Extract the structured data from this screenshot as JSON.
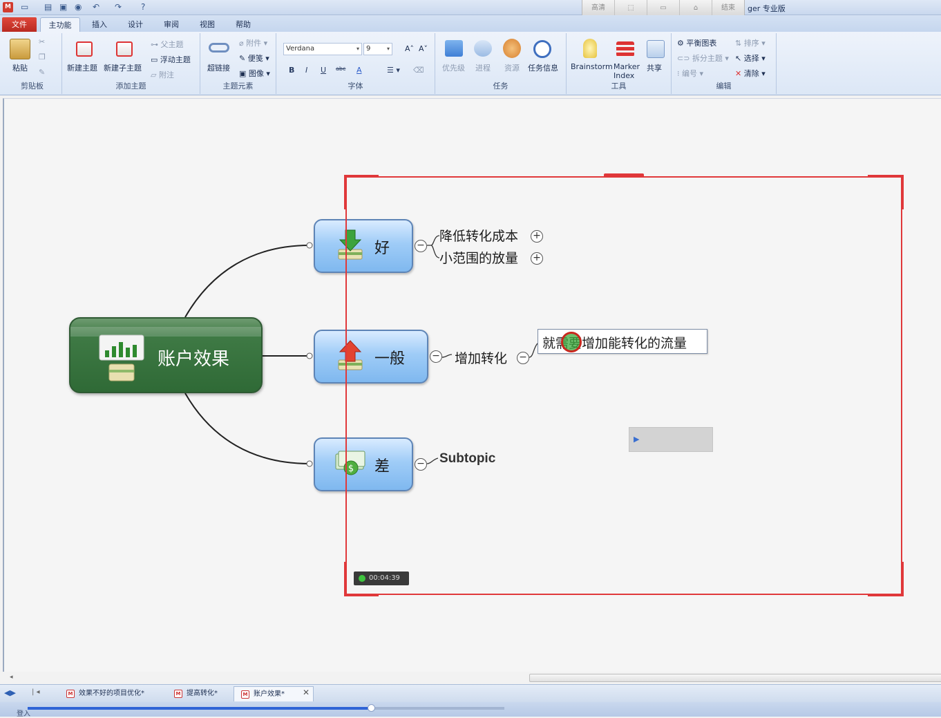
{
  "titlebar": {
    "app_title": "ger 专业版",
    "recorder_buttons": [
      "高清",
      "",
      "",
      "",
      "结束"
    ]
  },
  "tabs": [
    "文件",
    "主功能",
    "插入",
    "设计",
    "审阅",
    "视图",
    "帮助"
  ],
  "ribbon": {
    "clipboard": {
      "paste": "粘贴",
      "label": "剪贴板"
    },
    "add_topic": {
      "new_topic": "新建主题",
      "new_subtopic": "新建子主题",
      "callout": "父主题",
      "floating": "浮动主题",
      "note": "附注",
      "label": "添加主题"
    },
    "elements": {
      "hyperlink": "超链接",
      "attachment": "附件",
      "notes": "便笺",
      "image": "图像",
      "label": "主题元素"
    },
    "font": {
      "family": "Verdana",
      "size": "9",
      "bold": "B",
      "italic": "I",
      "underline": "U",
      "strike": "abc",
      "color": "A",
      "label": "字体"
    },
    "task": {
      "priority": "优先级",
      "progress": "进程",
      "resource": "资源",
      "task_info": "任务信息",
      "label": "任务"
    },
    "tools": {
      "brainstorm": "Brainstorm",
      "marker_index_1": "Marker",
      "marker_index_2": "Index",
      "share": "共享",
      "label": "工具"
    },
    "edit": {
      "balance_map": "平衡图表",
      "split_topic": "拆分主题",
      "numbering": "编号",
      "sort": "排序",
      "select": "选择",
      "clear": "清除",
      "label": "编辑"
    }
  },
  "map": {
    "central": "账户效果",
    "branches": [
      {
        "label": "好",
        "subtopics": [
          "降低转化成本",
          "小范围的放量"
        ]
      },
      {
        "label": "一般",
        "subtopics": [
          "增加转化"
        ]
      },
      {
        "label": "差",
        "subtopics": [
          "Subtopic"
        ]
      }
    ],
    "editing_text": "就需要增加能转化的流量",
    "timer": "00:04:39"
  },
  "doc_tabs": [
    "效果不好的项目优化*",
    "提高转化*",
    "账户效果*"
  ],
  "status": {
    "text": "登入",
    "progress": 0.72
  },
  "colors": {
    "accent_red": "#e0383a",
    "file_tab": "#c62f24",
    "central_green": "#3f7a45"
  }
}
